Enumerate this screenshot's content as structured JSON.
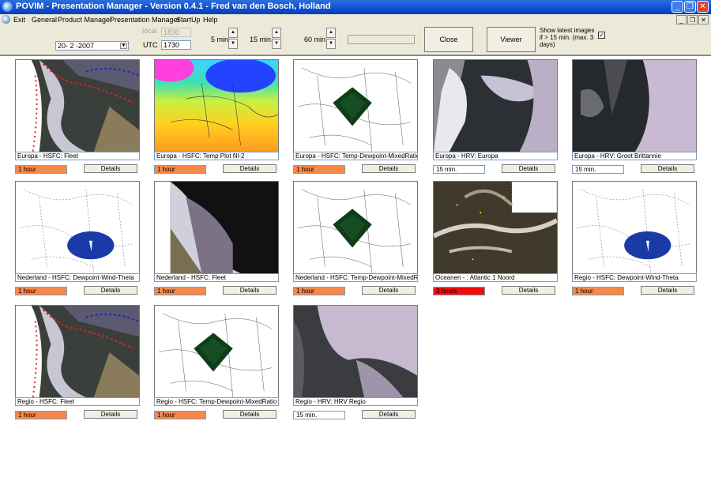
{
  "window": {
    "title": "POVIM - Presentation Manager - Version 0.4.1 - Fred van den Bosch, Holland"
  },
  "menu": {
    "items": [
      "Exit",
      "General",
      "Product Manager",
      "Presentation Manager",
      "StartUp",
      "Help"
    ]
  },
  "toolbar": {
    "date_value": "20- 2 -2007",
    "local_label": "local",
    "local_value": "1830",
    "utc_label": "UTC",
    "utc_value": "1730",
    "step_5": "5 min.",
    "step_15": "15 min.",
    "step_60": "60 min.",
    "close_label": "Close",
    "viewer_label": "Viewer",
    "show_latest_label": "Show latest images if > 15 min. (max. 3 days)",
    "show_latest_checked": true
  },
  "details_label": "Details",
  "tiles": [
    {
      "caption": "Europa -  HSFC: Fleet",
      "age": "1 hour",
      "status": "orange",
      "kind": "sat-front"
    },
    {
      "caption": "Europa -  HSFC: Temp Plot fill-2",
      "age": "1 hour",
      "status": "orange",
      "kind": "temp"
    },
    {
      "caption": "Europa -  HSFC: Temp-Dewpoint-MixedRatio",
      "age": "1 hour",
      "status": "orange",
      "kind": "map-green"
    },
    {
      "caption": "Europa - HRV: Europa",
      "age": "15 min.",
      "status": "white",
      "kind": "sat"
    },
    {
      "caption": "Europa - HRV: Groot Brittannie",
      "age": "15 min.",
      "status": "white",
      "kind": "sat2"
    },
    {
      "caption": "Nederland -  HSFC: Dewpoint-Wind-Theta",
      "age": "1 hour",
      "status": "orange",
      "kind": "map-blue"
    },
    {
      "caption": "Nederland -  HSFC: Fleet",
      "age": "1 hour",
      "status": "orange",
      "kind": "sat-dark"
    },
    {
      "caption": "Nederland -  HSFC: Temp-Dewpoint-MixedRatio",
      "age": "1 hour",
      "status": "orange",
      "kind": "map-green"
    },
    {
      "caption": "Oceanen - : Atlantic 1 Noord",
      "age": "3 hours",
      "status": "red",
      "kind": "ocean"
    },
    {
      "caption": "Regio -  HSFC: Dewpoint-Wind-Theta",
      "age": "1 hour",
      "status": "orange",
      "kind": "map-blue"
    },
    {
      "caption": "Regio -  HSFC: Fleet",
      "age": "1 hour",
      "status": "orange",
      "kind": "sat-front"
    },
    {
      "caption": "Regio -  HSFC: Temp-Dewpoint-MixedRatio",
      "age": "1 hour",
      "status": "orange",
      "kind": "map-green"
    },
    {
      "caption": "Regio - HRV: HRV Regio",
      "age": "15 min.",
      "status": "white",
      "kind": "sat3"
    }
  ],
  "colors": {
    "orange": "#f5894b",
    "red": "#f40a0a",
    "titlebar": "#0f4fcf"
  }
}
